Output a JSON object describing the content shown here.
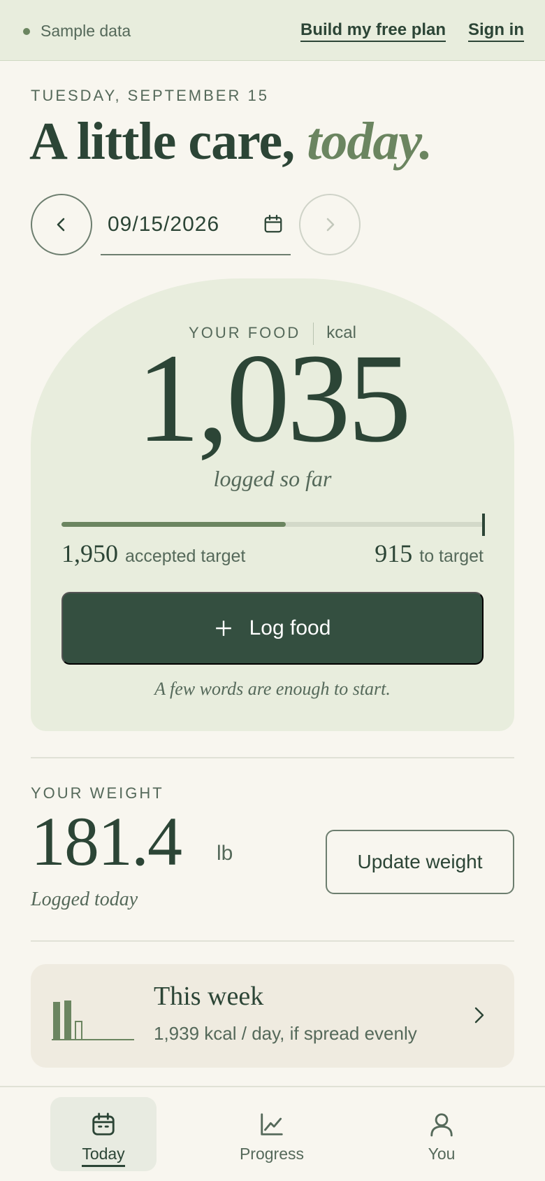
{
  "banner": {
    "status": "Sample data",
    "build_plan": "Build my free plan",
    "sign_in": "Sign in"
  },
  "header": {
    "date_label": "TUESDAY, SEPTEMBER 15",
    "headline_main": "A little care,",
    "headline_accent": "today."
  },
  "date_picker": {
    "value": "09/15/2026"
  },
  "food": {
    "label": "YOUR FOOD",
    "unit": "kcal",
    "logged": "1,035",
    "logged_caption": "logged so far",
    "progress_fraction": 0.531,
    "accepted_target": "1,950",
    "accepted_target_label": "accepted target",
    "remaining": "915",
    "remaining_label": "to target",
    "log_button": "Log food",
    "hint": "A few words are enough to start."
  },
  "weight": {
    "label": "YOUR WEIGHT",
    "value": "181.4",
    "unit": "lb",
    "caption": "Logged today",
    "update_button": "Update weight"
  },
  "week": {
    "title": "This week",
    "summary": "1,939 kcal / day, if spread evenly"
  },
  "nav": {
    "items": [
      {
        "label": "Today",
        "icon": "calendar-icon",
        "active": true
      },
      {
        "label": "Progress",
        "icon": "chart-line-icon",
        "active": false
      },
      {
        "label": "You",
        "icon": "user-icon",
        "active": false
      }
    ]
  },
  "colors": {
    "accent": "#6b8560",
    "primary": "#344f40",
    "card": "#e8eddd",
    "background": "#f8f6ef"
  }
}
